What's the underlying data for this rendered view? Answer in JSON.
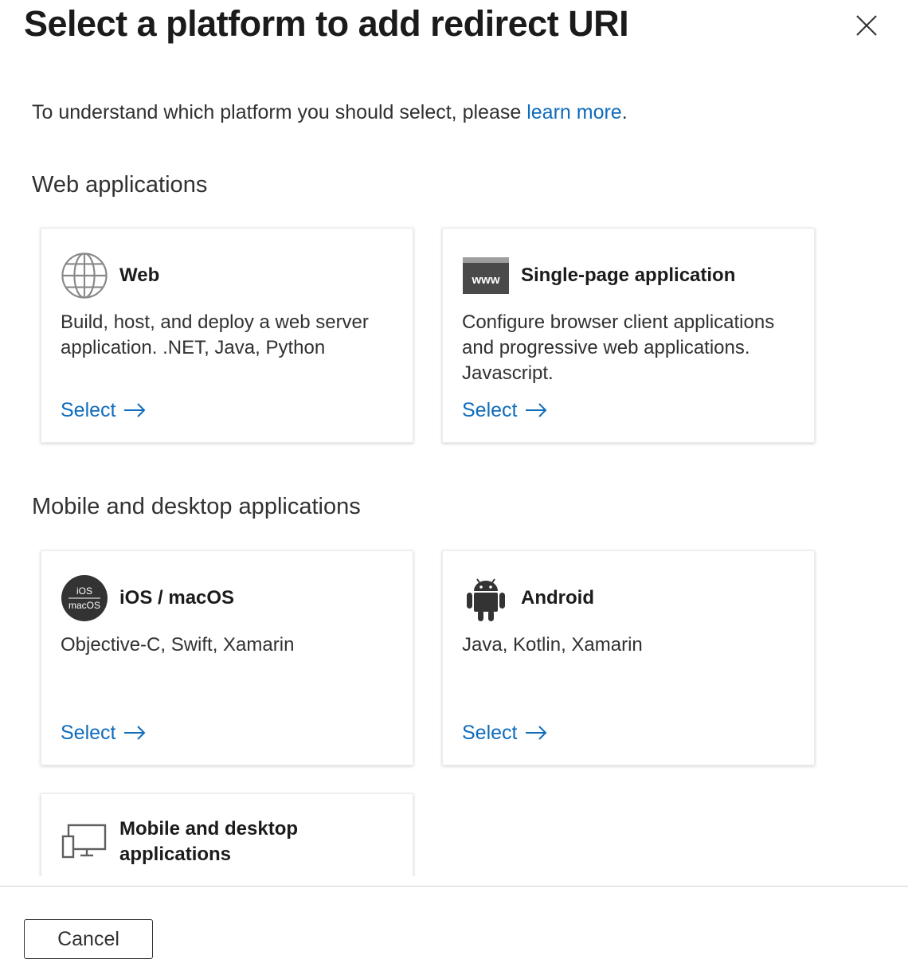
{
  "dialog": {
    "title": "Select a platform to add redirect URI",
    "intro_prefix": "To understand which platform you should select, please ",
    "intro_link": "learn more",
    "intro_suffix": "."
  },
  "sections": [
    {
      "heading": "Web applications",
      "cards": [
        {
          "icon": "globe-icon",
          "title": "Web",
          "description": "Build, host, and deploy a web server application. .NET, Java, Python",
          "action": "Select"
        },
        {
          "icon": "www-window-icon",
          "icon_text": "www",
          "title": "Single-page application",
          "description": "Configure browser client applications and progressive web applications. Javascript.",
          "action": "Select"
        }
      ]
    },
    {
      "heading": "Mobile and desktop applications",
      "cards": [
        {
          "icon": "ios-macos-icon",
          "icon_text_top": "iOS",
          "icon_text_bottom": "macOS",
          "title": "iOS / macOS",
          "description": "Objective-C, Swift, Xamarin",
          "action": "Select"
        },
        {
          "icon": "android-icon",
          "title": "Android",
          "description": "Java, Kotlin, Xamarin",
          "action": "Select"
        },
        {
          "icon": "desktop-icon",
          "title": "Mobile and desktop applications"
        }
      ]
    }
  ],
  "footer": {
    "cancel_label": "Cancel"
  },
  "colors": {
    "link": "#0f6cbd",
    "text": "#323130",
    "icon_dark": "#333333"
  }
}
